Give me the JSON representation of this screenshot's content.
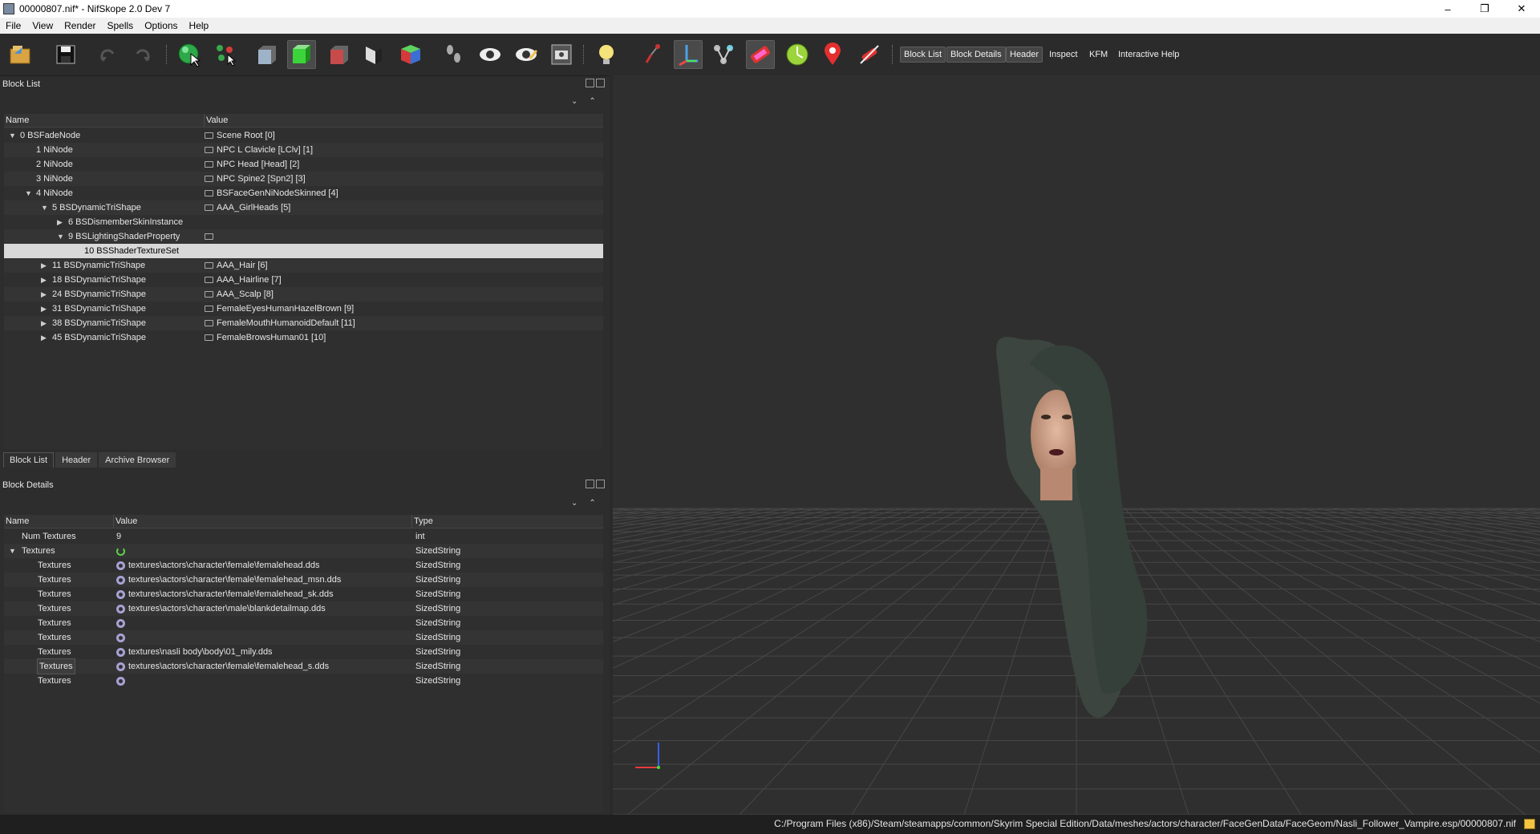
{
  "window": {
    "title": "00000807.nif* - NifSkope 2.0 Dev 7",
    "minimize": "–",
    "restore": "❐",
    "close": "✕"
  },
  "menu": [
    "File",
    "View",
    "Render",
    "Spells",
    "Options",
    "Help"
  ],
  "toolbar": {
    "text_buttons": [
      "Block List",
      "Block Details",
      "Header",
      "Inspect",
      "KFM",
      "Interactive Help"
    ]
  },
  "block_list": {
    "title": "Block List",
    "columns": [
      "Name",
      "Value"
    ],
    "rows": [
      {
        "name": "0 BSFadeNode",
        "value": "Scene Root [0]",
        "depth": 0,
        "arrow": "down",
        "icon": true
      },
      {
        "name": "1 NiNode",
        "value": "NPC L Clavicle [LClv] [1]",
        "depth": 1,
        "arrow": "",
        "icon": true
      },
      {
        "name": "2 NiNode",
        "value": "NPC Head [Head] [2]",
        "depth": 1,
        "arrow": "",
        "icon": true
      },
      {
        "name": "3 NiNode",
        "value": "NPC Spine2 [Spn2] [3]",
        "depth": 1,
        "arrow": "",
        "icon": true
      },
      {
        "name": "4 NiNode",
        "value": "BSFaceGenNiNodeSkinned [4]",
        "depth": 1,
        "arrow": "down",
        "icon": true
      },
      {
        "name": "5 BSDynamicTriShape",
        "value": "AAA_GirlHeads [5]",
        "depth": 2,
        "arrow": "down",
        "icon": true
      },
      {
        "name": "6 BSDismemberSkinInstance",
        "value": "",
        "depth": 3,
        "arrow": "right",
        "icon": false
      },
      {
        "name": "9 BSLightingShaderProperty",
        "value": "",
        "depth": 3,
        "arrow": "down",
        "icon": true
      },
      {
        "name": "10 BSShaderTextureSet",
        "value": "",
        "depth": 4,
        "arrow": "",
        "icon": false,
        "selected": true
      },
      {
        "name": "11 BSDynamicTriShape",
        "value": "AAA_Hair [6]",
        "depth": 2,
        "arrow": "right",
        "icon": true
      },
      {
        "name": "18 BSDynamicTriShape",
        "value": "AAA_Hairline [7]",
        "depth": 2,
        "arrow": "right",
        "icon": true
      },
      {
        "name": "24 BSDynamicTriShape",
        "value": "AAA_Scalp [8]",
        "depth": 2,
        "arrow": "right",
        "icon": true
      },
      {
        "name": "31 BSDynamicTriShape",
        "value": "FemaleEyesHumanHazelBrown [9]",
        "depth": 2,
        "arrow": "right",
        "icon": true
      },
      {
        "name": "38 BSDynamicTriShape",
        "value": "FemaleMouthHumanoidDefault [11]",
        "depth": 2,
        "arrow": "right",
        "icon": true
      },
      {
        "name": "45 BSDynamicTriShape",
        "value": "FemaleBrowsHuman01 [10]",
        "depth": 2,
        "arrow": "right",
        "icon": true
      }
    ]
  },
  "tabs": [
    "Block List",
    "Header",
    "Archive Browser"
  ],
  "block_details": {
    "title": "Block Details",
    "columns": [
      "Name",
      "Value",
      "Type"
    ],
    "rows": [
      {
        "name": "Num Textures",
        "value": "9",
        "type": "int",
        "depth": 1,
        "arrow": "",
        "icon": "none"
      },
      {
        "name": "Textures",
        "value": "",
        "type": "SizedString",
        "depth": 1,
        "arrow": "down",
        "icon": "refresh"
      },
      {
        "name": "Textures",
        "value": "textures\\actors\\character\\female\\femalehead.dds",
        "type": "SizedString",
        "depth": 2,
        "arrow": "",
        "icon": "gear"
      },
      {
        "name": "Textures",
        "value": "textures\\actors\\character\\female\\femalehead_msn.dds",
        "type": "SizedString",
        "depth": 2,
        "arrow": "",
        "icon": "gear"
      },
      {
        "name": "Textures",
        "value": "textures\\actors\\character\\female\\femalehead_sk.dds",
        "type": "SizedString",
        "depth": 2,
        "arrow": "",
        "icon": "gear"
      },
      {
        "name": "Textures",
        "value": "textures\\actors\\character\\male\\blankdetailmap.dds",
        "type": "SizedString",
        "depth": 2,
        "arrow": "",
        "icon": "gear"
      },
      {
        "name": "Textures",
        "value": "",
        "type": "SizedString",
        "depth": 2,
        "arrow": "",
        "icon": "gear"
      },
      {
        "name": "Textures",
        "value": "",
        "type": "SizedString",
        "depth": 2,
        "arrow": "",
        "icon": "gear"
      },
      {
        "name": "Textures",
        "value": "textures\\nasli body\\body\\01_mily.dds",
        "type": "SizedString",
        "depth": 2,
        "arrow": "",
        "icon": "gear"
      },
      {
        "name": "Textures",
        "value": "textures\\actors\\character\\female\\femalehead_s.dds",
        "type": "SizedString",
        "depth": 2,
        "arrow": "",
        "icon": "gear",
        "focused": true
      },
      {
        "name": "Textures",
        "value": "",
        "type": "SizedString",
        "depth": 2,
        "arrow": "",
        "icon": "gear"
      }
    ]
  },
  "status": {
    "path": "C:/Program Files (x86)/Steam/steamapps/common/Skyrim Special Edition/Data/meshes/actors/character/FaceGenData/FaceGeom/Nasli_Follower_Vampire.esp/00000807.nif"
  }
}
